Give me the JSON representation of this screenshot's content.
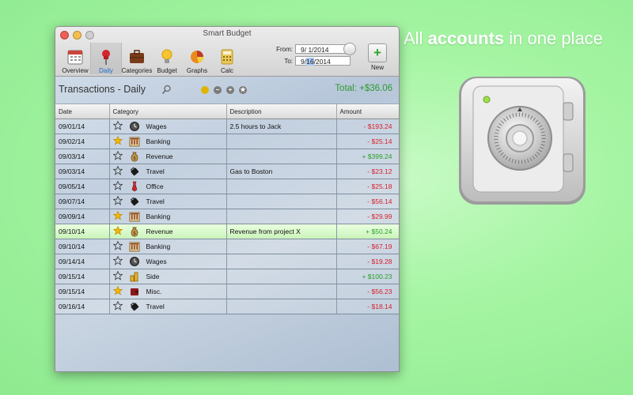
{
  "promo": {
    "prefix": "All ",
    "bold": "accounts",
    "suffix": " in one place"
  },
  "window": {
    "title": "Smart Budget"
  },
  "toolbar": {
    "items": [
      {
        "label": "Overview",
        "icon": "calendar-icon"
      },
      {
        "label": "Daily",
        "icon": "pushpin-icon",
        "selected": true
      },
      {
        "label": "Categories",
        "icon": "briefcase-icon"
      },
      {
        "label": "Budget",
        "icon": "lightbulb-icon"
      },
      {
        "label": "Graphs",
        "icon": "pie-chart-icon"
      },
      {
        "label": "Calc",
        "icon": "calculator-icon"
      }
    ],
    "new_label": "New"
  },
  "dates": {
    "from_label": "From:",
    "from_value": "9/  1/2014",
    "to_label": "To:",
    "to_value_pre": "9/",
    "to_value_hl": "16",
    "to_value_post": "/2014"
  },
  "header": {
    "title": "Transactions - Daily",
    "total": "Total: +$36.06"
  },
  "columns": [
    "Date",
    "Category",
    "Description",
    "Amount"
  ],
  "rows": [
    {
      "date": "09/01/14",
      "starred": false,
      "category": "Wages",
      "icon": "clock-icon",
      "description": "2.5 hours to Jack",
      "amount": "- $193.24",
      "sign": "neg"
    },
    {
      "date": "09/02/14",
      "starred": true,
      "category": "Banking",
      "icon": "bank-icon",
      "description": "",
      "amount": "- $25.14",
      "sign": "neg"
    },
    {
      "date": "09/03/14",
      "starred": false,
      "category": "Revenue",
      "icon": "money-bag-icon",
      "description": "",
      "amount": "+ $399.24",
      "sign": "pos"
    },
    {
      "date": "09/03/14",
      "starred": false,
      "category": "Travel",
      "icon": "suitcase-icon",
      "description": "Gas to Boston",
      "amount": "- $23.12",
      "sign": "neg"
    },
    {
      "date": "09/05/14",
      "starred": false,
      "category": "Office",
      "icon": "tie-icon",
      "description": "",
      "amount": "- $25.18",
      "sign": "neg"
    },
    {
      "date": "09/07/14",
      "starred": false,
      "category": "Travel",
      "icon": "suitcase-icon",
      "description": "",
      "amount": "- $56.14",
      "sign": "neg"
    },
    {
      "date": "09/09/14",
      "starred": true,
      "category": "Banking",
      "icon": "bank-icon",
      "description": "",
      "amount": "- $29.99",
      "sign": "neg"
    },
    {
      "date": "09/10/14",
      "starred": true,
      "category": "Revenue",
      "icon": "money-bag-icon",
      "description": "Revenue from project X",
      "amount": "+ $50.24",
      "sign": "pos",
      "selected": true
    },
    {
      "date": "09/10/14",
      "starred": false,
      "category": "Banking",
      "icon": "bank-icon",
      "description": "",
      "amount": "- $67.19",
      "sign": "neg"
    },
    {
      "date": "09/14/14",
      "starred": false,
      "category": "Wages",
      "icon": "clock-icon",
      "description": "",
      "amount": "- $19.28",
      "sign": "neg"
    },
    {
      "date": "09/15/14",
      "starred": false,
      "category": "Side",
      "icon": "coins-icon",
      "description": "",
      "amount": "+ $100.23",
      "sign": "pos"
    },
    {
      "date": "09/15/14",
      "starred": true,
      "category": "Misc.",
      "icon": "wallet-icon",
      "description": "",
      "amount": "- $56.23",
      "sign": "neg"
    },
    {
      "date": "09/16/14",
      "starred": false,
      "category": "Travel",
      "icon": "suitcase-icon",
      "description": "",
      "amount": "- $18.14",
      "sign": "neg"
    }
  ],
  "colors": {
    "positive": "#28a028",
    "negative": "#d91f2b",
    "star": "#f2b705",
    "background": "#a6f5a4"
  }
}
